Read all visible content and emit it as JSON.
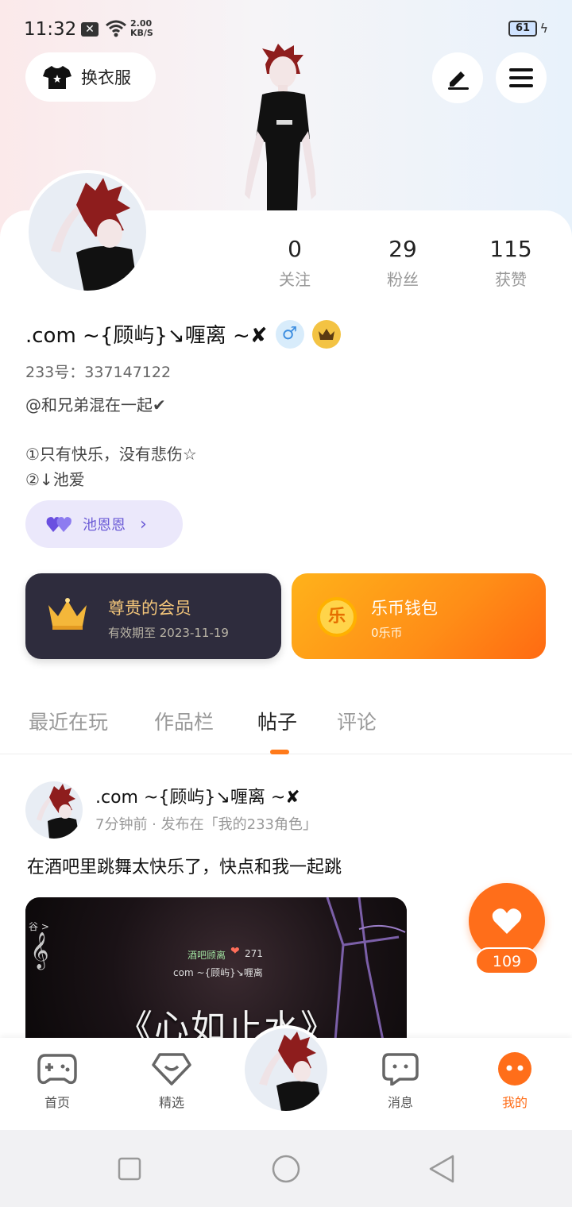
{
  "status_bar": {
    "time": "11:32",
    "speed_value": "2.00",
    "speed_unit": "KB/S",
    "battery": "61"
  },
  "header": {
    "outfit_label": "换衣服",
    "edit_icon": "pencil-icon",
    "menu_icon": "hamburger-menu-icon"
  },
  "stats": [
    {
      "value": "0",
      "label": "关注"
    },
    {
      "value": "29",
      "label": "粉丝"
    },
    {
      "value": "115",
      "label": "获赞"
    }
  ],
  "profile": {
    "name": ".com ~{顾屿}↘喱离 ~✘",
    "uid": "233号：337147122",
    "bio_line1": "@和兄弟混在一起✔",
    "bio_line2": "①只有快乐，没有悲伤☆",
    "bio_line3": "②↓池爱",
    "cp_label": "池恩恩"
  },
  "vip": {
    "title": "尊贵的会员",
    "expiry": "有效期至 2023-11-19"
  },
  "wallet": {
    "title": "乐币钱包",
    "balance": "0乐币",
    "coin_glyph": "乐"
  },
  "tabs": [
    {
      "label": "最近在玩",
      "active": false
    },
    {
      "label": "作品栏",
      "active": false
    },
    {
      "label": "帖子",
      "active": true
    },
    {
      "label": "评论",
      "active": false
    }
  ],
  "post": {
    "author": ".com ~{顾屿}↘喱离 ~✘",
    "meta": "7分钟前 · 发布在「我的233角色」",
    "text": "在酒吧里跳舞太快乐了，快点和我一起跳",
    "image_title": "《心如止水》",
    "image_top_left": "谷 >",
    "image_overlay_name": "酒吧顾离",
    "image_overlay_count": "271",
    "image_overlay_sub": "com ~{顾屿}↘喱离",
    "like_count": "109"
  },
  "bottom_nav": [
    {
      "label": "首页",
      "icon": "gamepad-icon",
      "active": false
    },
    {
      "label": "精选",
      "icon": "heart-diamond-icon",
      "active": false
    },
    {
      "label": "消息",
      "icon": "chat-bubble-icon",
      "active": false
    },
    {
      "label": "我的",
      "icon": "profile-face-icon",
      "active": true
    }
  ],
  "colors": {
    "accent": "#ff6e1a",
    "vip_bg": "#2e2c3d",
    "vip_text": "#f4c67a",
    "cp_text": "#6a5ad6"
  }
}
